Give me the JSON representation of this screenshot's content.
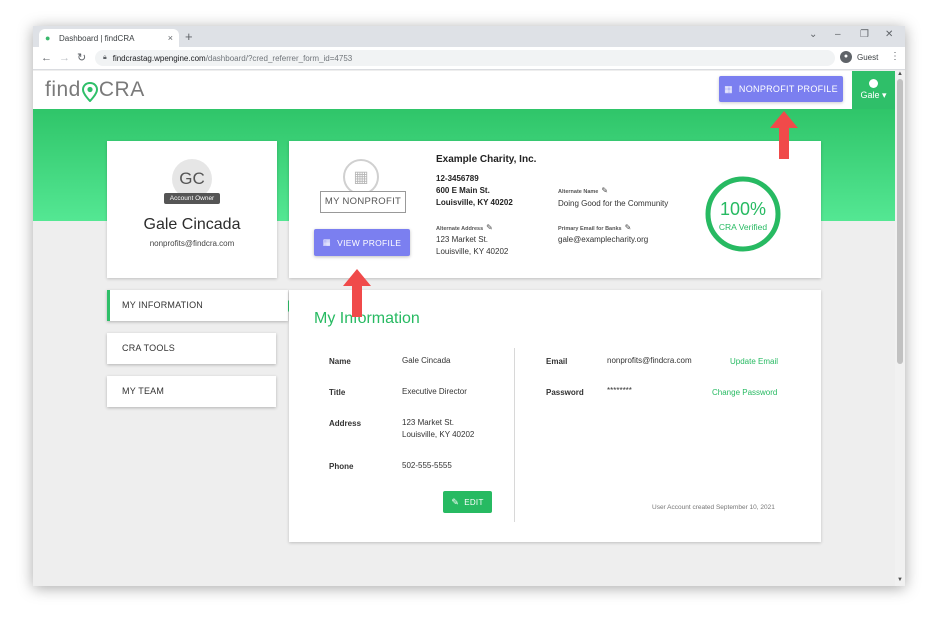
{
  "browser": {
    "tab_title": "Dashboard | findCRA",
    "tab_close": "×",
    "new_tab": "+",
    "url_host": "findcrastag.wpengine.com",
    "url_path": "/dashboard/?cred_referrer_form_id=4753",
    "profile_label": "Guest",
    "win_min": "–",
    "win_max": "❐",
    "win_close": "✕",
    "win_chevron": "⌄"
  },
  "nav": {
    "logo_find": "find",
    "logo_cra": "CRA",
    "nonprofit_profile_button": "NONPROFIT PROFILE",
    "user_menu_label": "Gale ▾"
  },
  "profile": {
    "initials": "GC",
    "role_badge": "Account Owner",
    "name": "Gale Cincada",
    "email": "nonprofits@findcra.com"
  },
  "org": {
    "my_nonprofit_label": "MY NONPROFIT",
    "view_profile_button": "VIEW PROFILE",
    "name": "Example Charity, Inc.",
    "ein": "12-3456789",
    "street": "600 E Main St.",
    "city_state": "Louisville, KY 40202",
    "alt_name_label": "Alternate Name",
    "alt_name_value": "Doing Good for the Community",
    "alt_address_label": "Alternate Address",
    "alt_address_line1": "123 Market St.",
    "alt_address_line2": "Louisville, KY 40202",
    "primary_email_label": "Primary Email for Banks",
    "primary_email_value": "gale@examplecharity.org",
    "verified_percent": "100%",
    "verified_fraction": 1.0,
    "verified_label": "CRA Verified"
  },
  "sidebar": {
    "items": [
      {
        "label": "MY INFORMATION"
      },
      {
        "label": "CRA TOOLS"
      },
      {
        "label": "MY TEAM"
      }
    ]
  },
  "my_info": {
    "title": "My Information",
    "name_label": "Name",
    "name_value": "Gale Cincada",
    "title_label": "Title",
    "title_value": "Executive Director",
    "address_label": "Address",
    "address_line1": "123 Market St.",
    "address_line2": "Louisville, KY 40202",
    "phone_label": "Phone",
    "phone_value": "502-555-5555",
    "edit_button": "EDIT",
    "email_label": "Email",
    "email_value": "nonprofits@findcra.com",
    "update_email_link": "Update Email",
    "password_label": "Password",
    "password_value": "********",
    "change_password_link": "Change Password",
    "created_note": "User Account created September 10, 2021"
  },
  "colors": {
    "brand_green": "#27ba62",
    "accent_purple": "#7b7ff0",
    "annotation_red": "#f04a4a"
  }
}
